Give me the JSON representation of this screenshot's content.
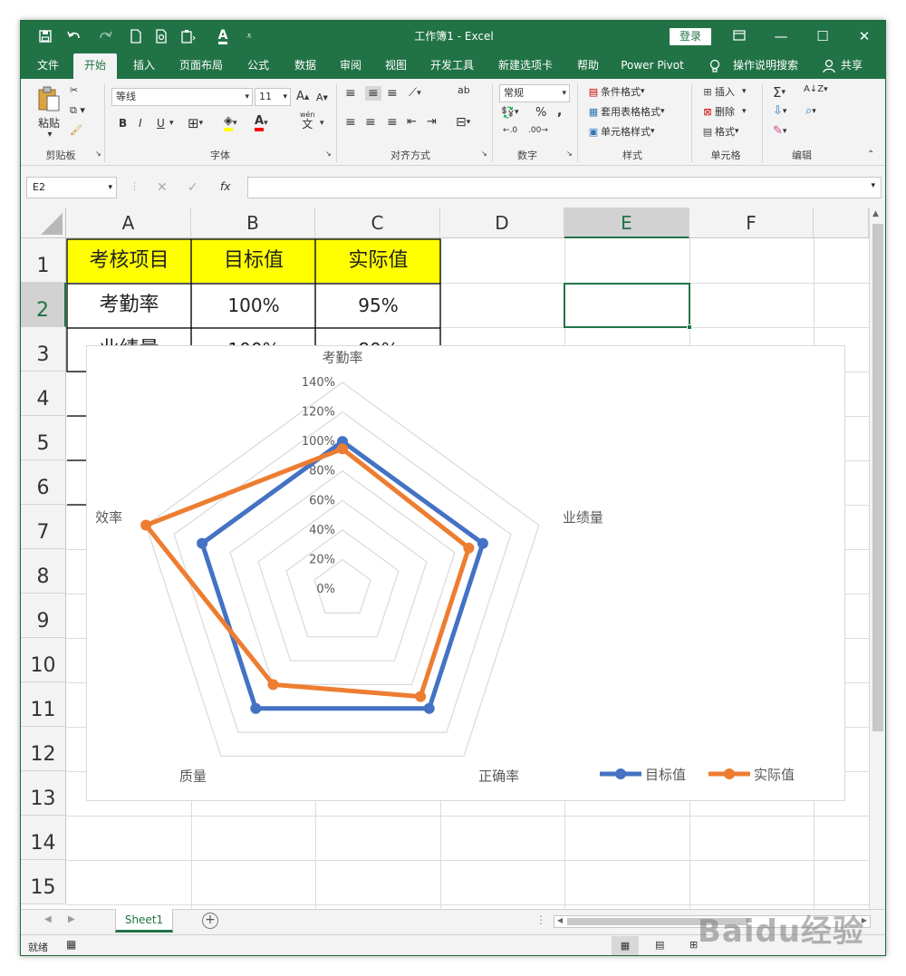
{
  "titlebar": {
    "title": "工作簿1  -  Excel",
    "login_label": "登录"
  },
  "tabs": [
    "文件",
    "开始",
    "插入",
    "页面布局",
    "公式",
    "数据",
    "审阅",
    "视图",
    "开发工具",
    "新建选项卡",
    "帮助",
    "Power Pivot",
    "操作说明搜索",
    "共享"
  ],
  "active_tab": "开始",
  "ribbon": {
    "clipboard": {
      "label": "剪贴板",
      "paste": "粘贴"
    },
    "font": {
      "label": "字体",
      "font_name": "等线",
      "font_size": "11",
      "bold": "B",
      "italic": "I",
      "underline": "U",
      "grow": "A",
      "shrink": "A",
      "font_color_glyph": "A",
      "wen": "wén",
      "wen_glyph": "文"
    },
    "align": {
      "label": "对齐方式",
      "ab": "ab"
    },
    "number": {
      "label": "数字",
      "format": "常规",
      "percent": "%",
      "comma": ","
    },
    "styles": {
      "label": "样式",
      "conditional": "条件格式",
      "table_format": "套用表格格式",
      "cell_styles": "单元格样式"
    },
    "cells": {
      "label": "单元格",
      "insert": "插入",
      "delete": "删除",
      "format": "格式"
    },
    "editing": {
      "label": "编辑"
    }
  },
  "formula_bar": {
    "name_box": "E2",
    "fx": "fx",
    "formula": ""
  },
  "columns": [
    "A",
    "B",
    "C",
    "D",
    "E",
    "F"
  ],
  "selected_column": "E",
  "rows": [
    "1",
    "2",
    "3",
    "4",
    "5",
    "6",
    "7",
    "8",
    "9",
    "10",
    "11",
    "12",
    "13",
    "14",
    "15"
  ],
  "selected_row": "2",
  "cells": {
    "A1": "考核项目",
    "B1": "目标值",
    "C1": "实际值",
    "A2": "考勤率",
    "B2": "100%",
    "C2": "95%",
    "A3": "业绩量",
    "B3": "100%",
    "C3": "80%"
  },
  "colors": {
    "excel_green": "#217346",
    "header_fill": "#ffff00",
    "series_target": "#4472c4",
    "series_actual": "#ed7d31"
  },
  "chart_data": {
    "type": "radar",
    "categories": [
      "考勤率",
      "业绩量",
      "正确率",
      "质量",
      "效率"
    ],
    "series": [
      {
        "name": "目标值",
        "values": [
          100,
          100,
          100,
          100,
          100
        ],
        "color": "#4472c4"
      },
      {
        "name": "实际值",
        "values": [
          95,
          90,
          90,
          80,
          140
        ],
        "color": "#ed7d31"
      }
    ],
    "radial_ticks": [
      "0%",
      "20%",
      "40%",
      "60%",
      "80%",
      "100%",
      "120%",
      "140%"
    ],
    "rmax": 140,
    "legend": "bottom-right",
    "grid": true
  },
  "sheet_tabs": [
    "Sheet1"
  ],
  "status": {
    "ready": "就绪"
  },
  "watermark": "Baidu经验"
}
